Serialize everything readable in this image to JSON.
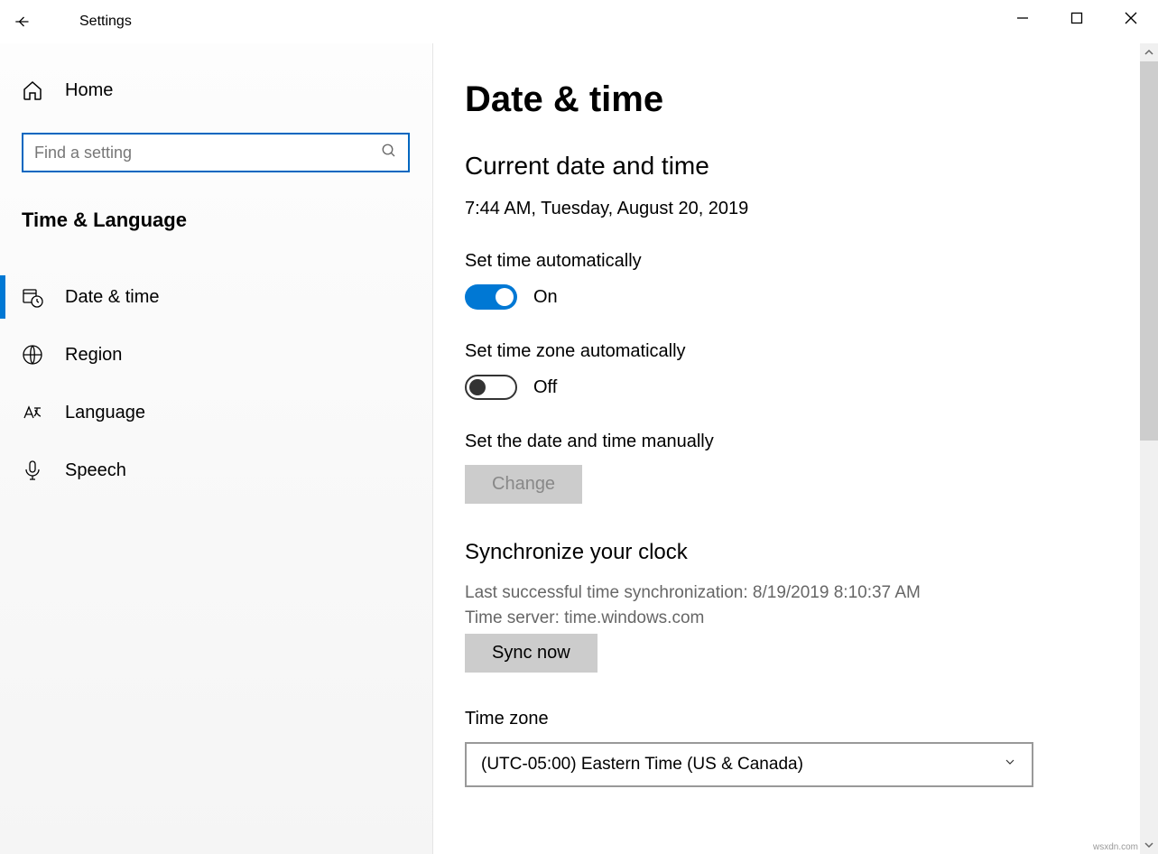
{
  "window": {
    "title": "Settings"
  },
  "sidebar": {
    "home": "Home",
    "search_placeholder": "Find a setting",
    "category": "Time & Language",
    "items": [
      {
        "label": "Date & time",
        "icon": "calendar-clock-icon",
        "active": true
      },
      {
        "label": "Region",
        "icon": "globe-icon",
        "active": false
      },
      {
        "label": "Language",
        "icon": "language-icon",
        "active": false
      },
      {
        "label": "Speech",
        "icon": "microphone-icon",
        "active": false
      }
    ]
  },
  "content": {
    "page_title": "Date & time",
    "current_heading": "Current date and time",
    "current_value": "7:44 AM, Tuesday, August 20, 2019",
    "auto_time": {
      "label": "Set time automatically",
      "state": "On",
      "on": true
    },
    "auto_tz": {
      "label": "Set time zone automatically",
      "state": "Off",
      "on": false
    },
    "manual": {
      "label": "Set the date and time manually",
      "button": "Change"
    },
    "sync": {
      "heading": "Synchronize your clock",
      "last": "Last successful time synchronization: 8/19/2019 8:10:37 AM",
      "server": "Time server: time.windows.com",
      "button": "Sync now"
    },
    "timezone": {
      "label": "Time zone",
      "value": "(UTC-05:00) Eastern Time (US & Canada)"
    }
  },
  "footer": {
    "watermark": "wsxdn.com"
  }
}
